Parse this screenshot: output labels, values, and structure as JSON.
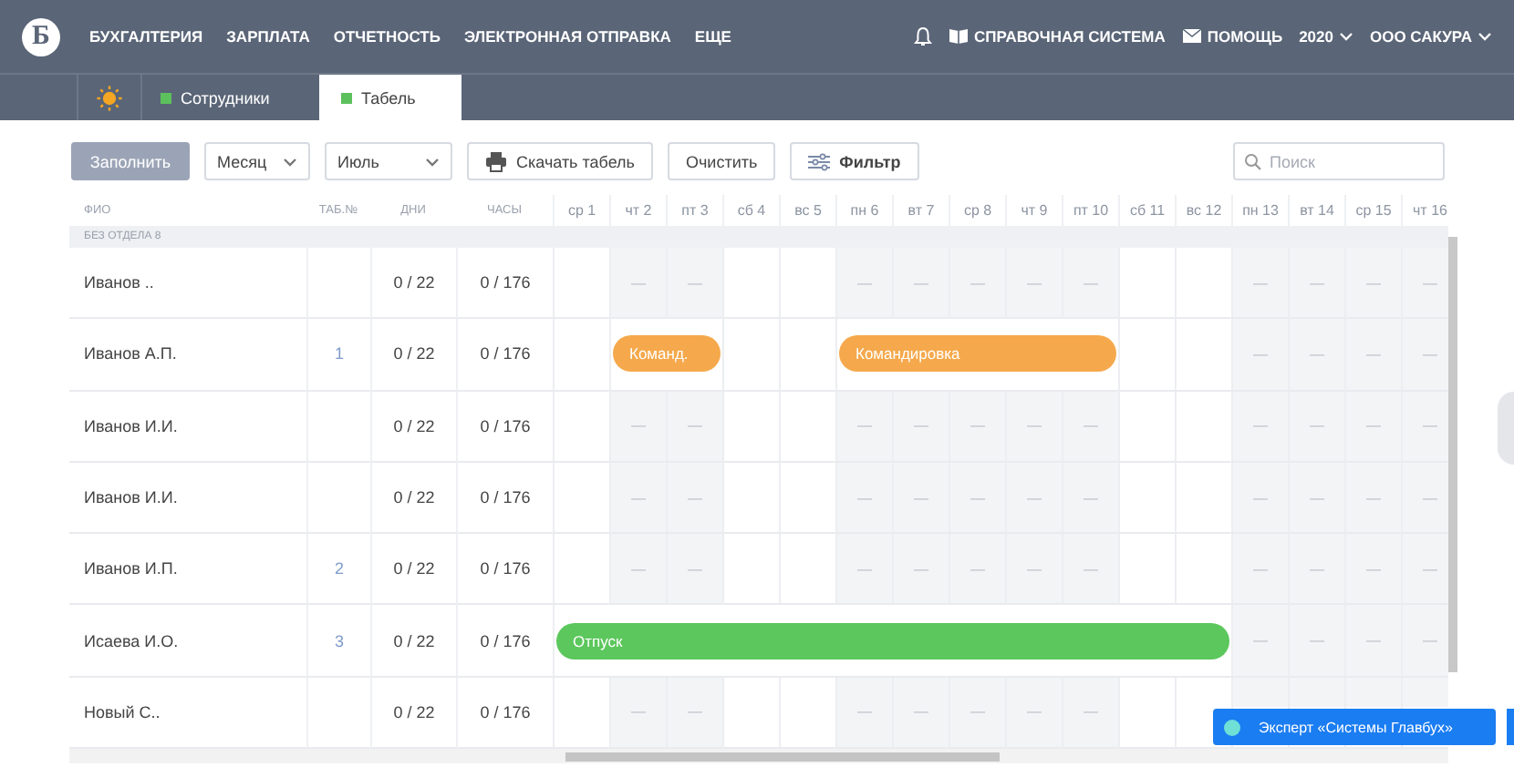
{
  "nav": {
    "logo": "Б",
    "items": [
      "БУХГАЛТЕРИЯ",
      "ЗАРПЛАТА",
      "ОТЧЕТНОСТЬ",
      "ЭЛЕКТРОННАЯ ОТПРАВКА",
      "ЕЩЕ"
    ],
    "links": [
      {
        "kind": "book",
        "label": "СПРАВОЧНАЯ СИСТЕМА"
      },
      {
        "kind": "mail",
        "label": "ПОМОЩЬ"
      }
    ],
    "year": "2020",
    "org": "ООО САКУРА"
  },
  "tabs": [
    {
      "kind": "icon",
      "selected": false
    },
    {
      "kind": "page",
      "label": "Сотрудники",
      "selected": false
    },
    {
      "kind": "page",
      "label": "Табель",
      "selected": true
    }
  ],
  "toolbar": {
    "fill_button": "Заполнить",
    "period_select": "Месяц",
    "month_select": "Июль",
    "download_button": "Скачать табель",
    "clear_button": "Очистить",
    "filter_button": "Фильтр",
    "search": {
      "placeholder": "Поиск"
    }
  },
  "table": {
    "columns": [
      "ФИО",
      "ТАБ.№",
      "ДНИ",
      "ЧАСЫ"
    ],
    "days": [
      "ср 1",
      "чт 2",
      "пт 3",
      "сб 4",
      "вс 5",
      "пн 6",
      "вт 7",
      "ср 8",
      "чт 9",
      "пт 10",
      "сб 11",
      "вс 12",
      "пн 13",
      "вт 14",
      "ср 15",
      "чт 16"
    ],
    "group": "БЕЗ ОТДЕЛА 8",
    "rows": [
      {
        "name": "Иванов ..",
        "tab_no": "",
        "days": "0 / 22",
        "hours": "0 / 176",
        "cells": [
          {
            "kind": "blank"
          },
          {
            "kind": "dash",
            "text": "—"
          },
          {
            "kind": "dash",
            "text": "—"
          },
          {
            "kind": "blank"
          },
          {
            "kind": "blank"
          },
          {
            "kind": "dash",
            "text": "—"
          },
          {
            "kind": "dash",
            "text": "—"
          },
          {
            "kind": "dash",
            "text": "—"
          },
          {
            "kind": "dash",
            "text": "—"
          },
          {
            "kind": "dash",
            "text": "—"
          },
          {
            "kind": "blank"
          },
          {
            "kind": "blank"
          },
          {
            "kind": "dash",
            "text": "—"
          },
          {
            "kind": "dash",
            "text": "—"
          },
          {
            "kind": "dash",
            "text": "—"
          },
          {
            "kind": "dash",
            "text": "—"
          }
        ]
      },
      {
        "name": "Иванов А.П.",
        "tab_no": "1",
        "days": "0 / 22",
        "hours": "0 / 176",
        "cells": [
          {
            "kind": "blank"
          },
          {
            "kind": "bar",
            "text": "Команд.",
            "color": "#f5a94c"
          },
          {
            "kind": "more"
          },
          {
            "kind": "blank"
          },
          {
            "kind": "blank"
          },
          {
            "kind": "bar",
            "text": "Командировка",
            "color": "#f5a94c"
          },
          {
            "kind": "more"
          },
          {
            "kind": "more"
          },
          {
            "kind": "more"
          },
          {
            "kind": "more"
          },
          {
            "kind": "blank"
          },
          {
            "kind": "blank"
          },
          {
            "kind": "dash",
            "text": "—"
          },
          {
            "kind": "dash",
            "text": "—"
          },
          {
            "kind": "dash",
            "text": "—"
          },
          {
            "kind": "dash",
            "text": "—"
          }
        ]
      },
      {
        "name": "Иванов И.И.",
        "tab_no": "",
        "days": "0 / 22",
        "hours": "0 / 176",
        "cells": [
          {
            "kind": "blank"
          },
          {
            "kind": "dash",
            "text": "—"
          },
          {
            "kind": "dash",
            "text": "—"
          },
          {
            "kind": "blank"
          },
          {
            "kind": "blank"
          },
          {
            "kind": "dash",
            "text": "—"
          },
          {
            "kind": "dash",
            "text": "—"
          },
          {
            "kind": "dash",
            "text": "—"
          },
          {
            "kind": "dash",
            "text": "—"
          },
          {
            "kind": "dash",
            "text": "—"
          },
          {
            "kind": "blank"
          },
          {
            "kind": "blank"
          },
          {
            "kind": "dash",
            "text": "—"
          },
          {
            "kind": "dash",
            "text": "—"
          },
          {
            "kind": "dash",
            "text": "—"
          },
          {
            "kind": "dash",
            "text": "—"
          }
        ]
      },
      {
        "name": "Иванов И.И.",
        "tab_no": "",
        "days": "0 / 22",
        "hours": "0 / 176",
        "cells": [
          {
            "kind": "blank"
          },
          {
            "kind": "dash",
            "text": "—"
          },
          {
            "kind": "dash",
            "text": "—"
          },
          {
            "kind": "blank"
          },
          {
            "kind": "blank"
          },
          {
            "kind": "dash",
            "text": "—"
          },
          {
            "kind": "dash",
            "text": "—"
          },
          {
            "kind": "dash",
            "text": "—"
          },
          {
            "kind": "dash",
            "text": "—"
          },
          {
            "kind": "dash",
            "text": "—"
          },
          {
            "kind": "blank"
          },
          {
            "kind": "blank"
          },
          {
            "kind": "dash",
            "text": "—"
          },
          {
            "kind": "dash",
            "text": "—"
          },
          {
            "kind": "dash",
            "text": "—"
          },
          {
            "kind": "dash",
            "text": "—"
          }
        ]
      },
      {
        "name": "Иванов И.П.",
        "tab_no": "2",
        "days": "0 / 22",
        "hours": "0 / 176",
        "cells": [
          {
            "kind": "blank"
          },
          {
            "kind": "dash",
            "text": "—"
          },
          {
            "kind": "dash",
            "text": "—"
          },
          {
            "kind": "blank"
          },
          {
            "kind": "blank"
          },
          {
            "kind": "dash",
            "text": "—"
          },
          {
            "kind": "dash",
            "text": "—"
          },
          {
            "kind": "dash",
            "text": "—"
          },
          {
            "kind": "dash",
            "text": "—"
          },
          {
            "kind": "dash",
            "text": "—"
          },
          {
            "kind": "blank"
          },
          {
            "kind": "blank"
          },
          {
            "kind": "dash",
            "text": "—"
          },
          {
            "kind": "dash",
            "text": "—"
          },
          {
            "kind": "dash",
            "text": "—"
          },
          {
            "kind": "dash",
            "text": "—"
          }
        ]
      },
      {
        "name": "Исаева И.О.",
        "tab_no": "3",
        "days": "0 / 22",
        "hours": "0 / 176",
        "cells": [
          {
            "kind": "bar",
            "text": "Отпуск",
            "color": "#5cc75c"
          },
          {
            "kind": "more"
          },
          {
            "kind": "more"
          },
          {
            "kind": "more"
          },
          {
            "kind": "more"
          },
          {
            "kind": "more"
          },
          {
            "kind": "more"
          },
          {
            "kind": "more"
          },
          {
            "kind": "more"
          },
          {
            "kind": "more"
          },
          {
            "kind": "more"
          },
          {
            "kind": "more"
          },
          {
            "kind": "dash",
            "text": "—"
          },
          {
            "kind": "dash",
            "text": "—"
          },
          {
            "kind": "dash",
            "text": "—"
          },
          {
            "kind": "dash",
            "text": "—"
          }
        ]
      },
      {
        "name": "Новый С..",
        "tab_no": "",
        "days": "0 / 22",
        "hours": "0 / 176",
        "cells": [
          {
            "kind": "blank"
          },
          {
            "kind": "dash",
            "text": "—"
          },
          {
            "kind": "dash",
            "text": "—"
          },
          {
            "kind": "blank"
          },
          {
            "kind": "blank"
          },
          {
            "kind": "dash",
            "text": "—"
          },
          {
            "kind": "dash",
            "text": "—"
          },
          {
            "kind": "dash",
            "text": "—"
          },
          {
            "kind": "dash",
            "text": "—"
          },
          {
            "kind": "dash",
            "text": "—"
          },
          {
            "kind": "blank"
          },
          {
            "kind": "blank_top"
          },
          {
            "kind": "shaded"
          },
          {
            "kind": "shaded"
          },
          {
            "kind": "shaded"
          },
          {
            "kind": "shaded"
          }
        ]
      }
    ]
  },
  "expert_button": "Эксперт «Системы Главбух»"
}
